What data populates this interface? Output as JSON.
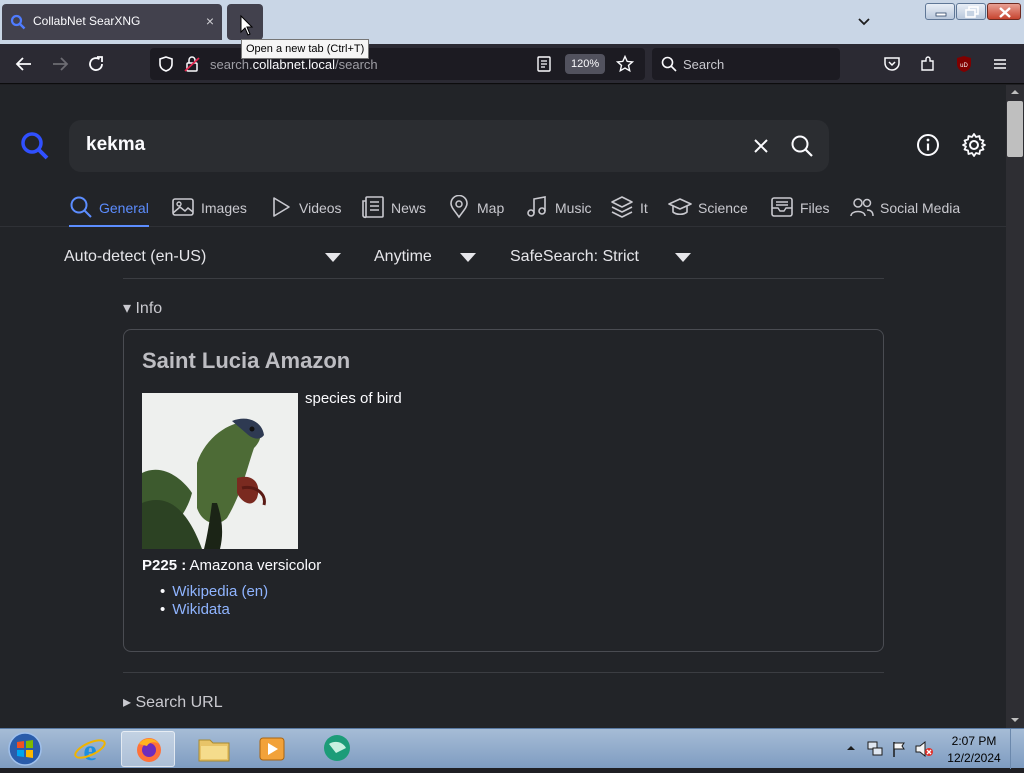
{
  "browser": {
    "tab": {
      "title": "CollabNet SearXNG",
      "close": "×"
    },
    "tooltip": "Open a new tab (Ctrl+T)",
    "url_prefix": "search.",
    "url_host": "collabnet.local",
    "url_path": "/search",
    "zoom": "120%",
    "search_placeholder": "Search"
  },
  "search": {
    "query": "kekma",
    "categories": [
      {
        "label": "General",
        "icon": "search-icon",
        "active": true
      },
      {
        "label": "Images",
        "icon": "image-icon"
      },
      {
        "label": "Videos",
        "icon": "play-icon"
      },
      {
        "label": "News",
        "icon": "newspaper-icon"
      },
      {
        "label": "Map",
        "icon": "map-pin-icon"
      },
      {
        "label": "Music",
        "icon": "music-note-icon"
      },
      {
        "label": "It",
        "icon": "layers-icon"
      },
      {
        "label": "Science",
        "icon": "graduation-cap-icon"
      },
      {
        "label": "Files",
        "icon": "inbox-icon"
      },
      {
        "label": "Social Media",
        "icon": "users-icon"
      }
    ],
    "filters": {
      "language": "Auto-detect (en-US)",
      "time": "Anytime",
      "safesearch": "SafeSearch: Strict"
    }
  },
  "infobox": {
    "summary": "▾ Info",
    "title": "Saint Lucia Amazon",
    "description": "species of bird",
    "attribute_label": "P225 :",
    "attribute_value": " Amazona versicolor",
    "links": [
      "Wikipedia (en)",
      "Wikidata"
    ]
  },
  "search_url_summary": "▸ Search URL",
  "taskbar": {
    "time": "2:07 PM",
    "date": "12/2/2024"
  },
  "colors": {
    "accent": "#5c8dff",
    "link": "#8fb4ff",
    "page_bg": "#222428"
  }
}
